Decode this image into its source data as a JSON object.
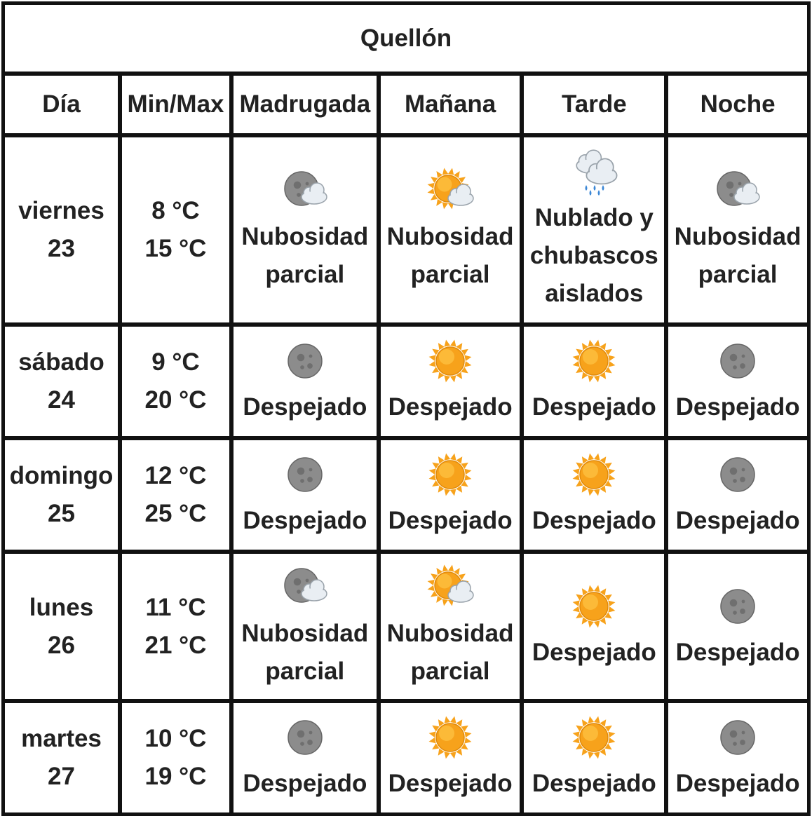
{
  "title": "Quellón",
  "headers": [
    "Día",
    "Min/Max",
    "Madrugada",
    "Mañana",
    "Tarde",
    "Noche"
  ],
  "icon_names": {
    "moon": "moon-icon",
    "sun": "sun-icon",
    "moon-cloud": "moon-cloud-icon",
    "sun-cloud": "sun-cloud-icon",
    "rain-cloud": "rain-cloud-icon"
  },
  "colors": {
    "sun": "#f7a21b",
    "moon": "#8c8c8c",
    "cloud": "#e9eef3",
    "rain": "#3b87d6"
  },
  "days": [
    {
      "day": "viernes",
      "date": "23",
      "min": "8 °C",
      "max": "15 °C",
      "periods": [
        {
          "icon": "moon-cloud",
          "lines": [
            "Nubosidad",
            "parcial"
          ]
        },
        {
          "icon": "sun-cloud",
          "lines": [
            "Nubosidad",
            "parcial"
          ]
        },
        {
          "icon": "rain-cloud",
          "lines": [
            "Nublado y",
            "chubascos",
            "aislados"
          ]
        },
        {
          "icon": "moon-cloud",
          "lines": [
            "Nubosidad",
            "parcial"
          ]
        }
      ]
    },
    {
      "day": "sábado",
      "date": "24",
      "min": "9 °C",
      "max": "20 °C",
      "periods": [
        {
          "icon": "moon",
          "lines": [
            "Despejado"
          ]
        },
        {
          "icon": "sun",
          "lines": [
            "Despejado"
          ]
        },
        {
          "icon": "sun",
          "lines": [
            "Despejado"
          ]
        },
        {
          "icon": "moon",
          "lines": [
            "Despejado"
          ]
        }
      ]
    },
    {
      "day": "domingo",
      "date": "25",
      "min": "12 °C",
      "max": "25 °C",
      "periods": [
        {
          "icon": "moon",
          "lines": [
            "Despejado"
          ]
        },
        {
          "icon": "sun",
          "lines": [
            "Despejado"
          ]
        },
        {
          "icon": "sun",
          "lines": [
            "Despejado"
          ]
        },
        {
          "icon": "moon",
          "lines": [
            "Despejado"
          ]
        }
      ]
    },
    {
      "day": "lunes",
      "date": "26",
      "min": "11 °C",
      "max": "21 °C",
      "periods": [
        {
          "icon": "moon-cloud",
          "lines": [
            "Nubosidad",
            "parcial"
          ]
        },
        {
          "icon": "sun-cloud",
          "lines": [
            "Nubosidad",
            "parcial"
          ]
        },
        {
          "icon": "sun",
          "lines": [
            "Despejado"
          ]
        },
        {
          "icon": "moon",
          "lines": [
            "Despejado"
          ]
        }
      ]
    },
    {
      "day": "martes",
      "date": "27",
      "min": "10 °C",
      "max": "19 °C",
      "periods": [
        {
          "icon": "moon",
          "lines": [
            "Despejado"
          ]
        },
        {
          "icon": "sun",
          "lines": [
            "Despejado"
          ]
        },
        {
          "icon": "sun",
          "lines": [
            "Despejado"
          ]
        },
        {
          "icon": "moon",
          "lines": [
            "Despejado"
          ]
        }
      ]
    }
  ]
}
